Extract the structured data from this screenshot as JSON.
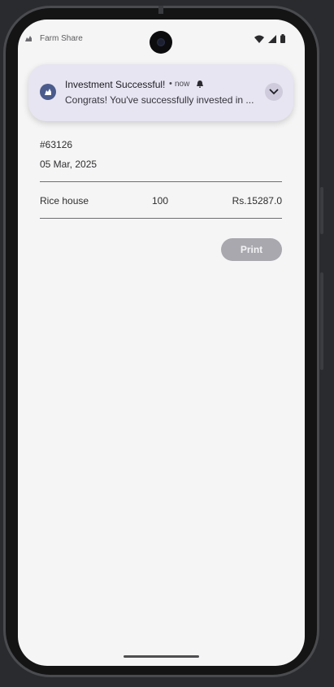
{
  "status_bar": {
    "app_name": "Farm Share",
    "app_icon": "farm-share-icon",
    "indicators": [
      "wifi-icon",
      "signal-icon",
      "battery-icon"
    ]
  },
  "notification": {
    "icon": "farm-share-icon",
    "title": "Investment Successful!",
    "separator": "•",
    "time": "now",
    "alert_icon": "bell-icon",
    "body": "Congrats! You've successfully invested in ...",
    "expand_icon": "chevron-down-icon",
    "colors": {
      "card": "#e7e5f1",
      "icon_bg": "#4b5b8c"
    }
  },
  "receipt": {
    "order_id": "#63126",
    "date": "05 Mar, 2025",
    "items": [
      {
        "name": "Rice house",
        "quantity": "100",
        "price": "Rs.15287.0"
      }
    ]
  },
  "actions": {
    "print_label": "Print",
    "print_color": "#a9a8ae"
  }
}
